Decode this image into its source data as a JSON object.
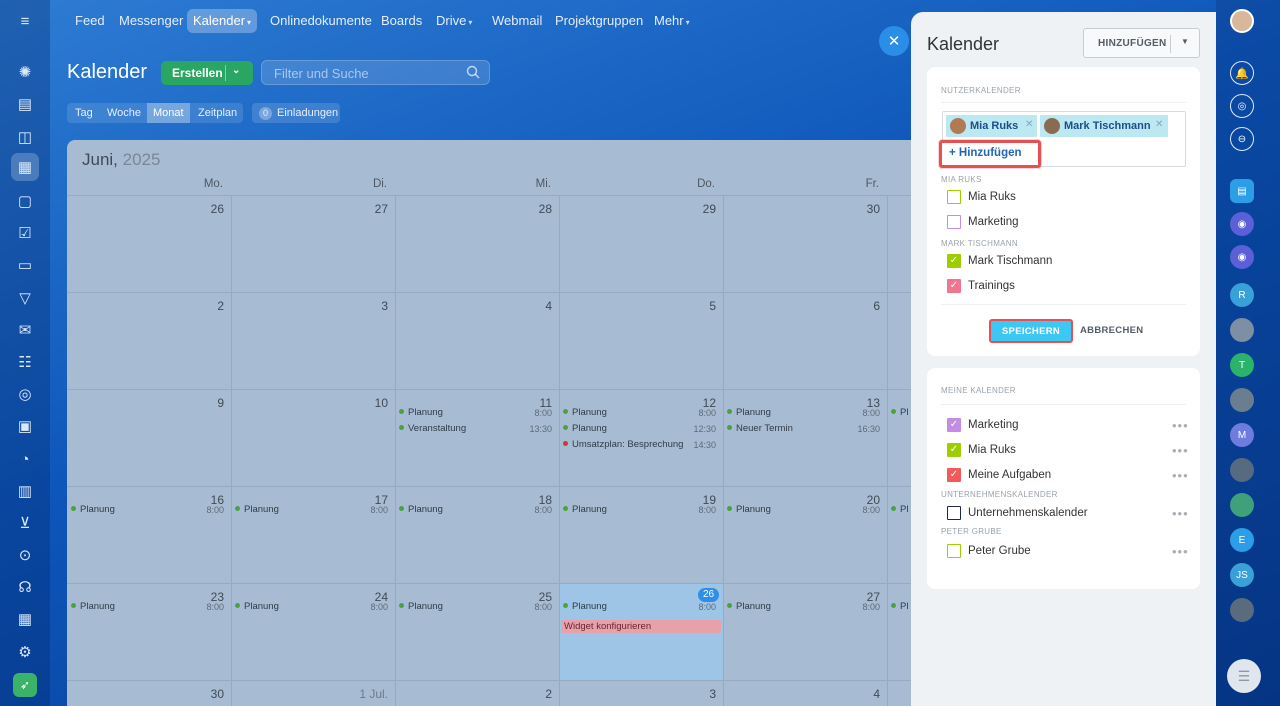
{
  "topnav": {
    "items": [
      {
        "label": "Feed"
      },
      {
        "label": "Messenger"
      },
      {
        "label": "Kalender"
      },
      {
        "label": "Onlinedokumente"
      },
      {
        "label": "Boards"
      },
      {
        "label": "Drive"
      },
      {
        "label": "Webmail"
      },
      {
        "label": "Projektgruppen"
      },
      {
        "label": "Mehr"
      }
    ]
  },
  "calendar": {
    "title": "Kalender",
    "create_label": "Erstellen",
    "search_placeholder": "Filter und Suche",
    "views": [
      "Tag",
      "Woche",
      "Monat",
      "Zeitplan"
    ],
    "active_view": "Monat",
    "invitations_count": "0",
    "invitations_label": "Einladungen",
    "month_name": "Juni,",
    "year": "2025",
    "weekdays": [
      "Mo.",
      "Di.",
      "Mi.",
      "Do.",
      "Fr."
    ],
    "weeks": [
      {
        "days": [
          {
            "num": "26",
            "events": []
          },
          {
            "num": "27",
            "events": []
          },
          {
            "num": "28",
            "events": []
          },
          {
            "num": "29",
            "events": []
          },
          {
            "num": "30",
            "events": []
          }
        ]
      },
      {
        "days": [
          {
            "num": "2",
            "events": []
          },
          {
            "num": "3",
            "events": []
          },
          {
            "num": "4",
            "events": []
          },
          {
            "num": "5",
            "events": []
          },
          {
            "num": "6",
            "events": []
          }
        ]
      },
      {
        "days": [
          {
            "num": "9",
            "events": []
          },
          {
            "num": "10",
            "events": []
          },
          {
            "num": "11",
            "events": [
              {
                "title": "Planung",
                "time": "8:00"
              },
              {
                "title": "Veranstaltung",
                "time": "13:30"
              }
            ]
          },
          {
            "num": "12",
            "events": [
              {
                "title": "Planung",
                "time": "8:00"
              },
              {
                "title": "Planung",
                "time": "12:30"
              },
              {
                "title": "Umsatzplan: Besprechung",
                "time": "14:30",
                "color": "red"
              }
            ]
          },
          {
            "num": "13",
            "events": [
              {
                "title": "Planung",
                "time": "8:00"
              },
              {
                "title": "Neuer Termin",
                "time": "16:30"
              }
            ]
          }
        ]
      },
      {
        "days": [
          {
            "num": "16",
            "events": [
              {
                "title": "Planung",
                "time": "8:00"
              }
            ]
          },
          {
            "num": "17",
            "events": [
              {
                "title": "Planung",
                "time": "8:00"
              }
            ]
          },
          {
            "num": "18",
            "events": [
              {
                "title": "Planung",
                "time": "8:00"
              }
            ]
          },
          {
            "num": "19",
            "events": [
              {
                "title": "Planung",
                "time": "8:00"
              }
            ]
          },
          {
            "num": "20",
            "events": [
              {
                "title": "Planung",
                "time": "8:00"
              }
            ]
          }
        ]
      },
      {
        "days": [
          {
            "num": "23",
            "events": [
              {
                "title": "Planung",
                "time": "8:00"
              }
            ]
          },
          {
            "num": "24",
            "events": [
              {
                "title": "Planung",
                "time": "8:00"
              }
            ]
          },
          {
            "num": "25",
            "events": [
              {
                "title": "Planung",
                "time": "8:00"
              }
            ]
          },
          {
            "num": "26",
            "today": true,
            "events": [
              {
                "title": "Planung",
                "time": "8:00"
              }
            ]
          },
          {
            "num": "27",
            "events": [
              {
                "title": "Planung",
                "time": "8:00"
              }
            ]
          }
        ]
      },
      {
        "days": [
          {
            "num": "30",
            "events": []
          },
          {
            "num": "1 Jul.",
            "events": []
          },
          {
            "num": "2",
            "events": []
          },
          {
            "num": "3",
            "events": []
          },
          {
            "num": "4",
            "events": []
          }
        ]
      }
    ],
    "widget_event": "Widget konfigurieren",
    "overflow_label": "Pl"
  },
  "panel": {
    "title": "Kalender",
    "add_button_label": "HINZUFÜGEN",
    "user_calendars_heading": "NUTZERKALENDER",
    "selected_users": [
      {
        "name": "Mia Ruks",
        "avatar_color": "#b07a55"
      },
      {
        "name": "Mark Tischmann",
        "avatar_color": "#8a6a50"
      }
    ],
    "add_user_label": "+ Hinzufügen",
    "groups": [
      {
        "heading": "MIA RUKS",
        "items": [
          {
            "label": "Mia Ruks",
            "color": "#9dcf00",
            "checked": false
          },
          {
            "label": "Marketing",
            "color": "#c38de3",
            "checked": false
          }
        ]
      },
      {
        "heading": "MARK TISCHMANN",
        "items": [
          {
            "label": "Mark Tischmann",
            "color": "#9dcf00",
            "checked": true
          },
          {
            "label": "Trainings",
            "color": "#f0758e",
            "checked": true
          }
        ]
      }
    ],
    "save_label": "SPEICHERN",
    "cancel_label": "ABBRECHEN",
    "my_calendars_heading": "MEINE KALENDER",
    "my_calendars": [
      {
        "label": "Marketing",
        "color": "#c38de3",
        "checked": true
      },
      {
        "label": "Mia Ruks",
        "color": "#9dcf00",
        "checked": true
      },
      {
        "label": "Meine Aufgaben",
        "color": "#f25a5a",
        "checked": true
      }
    ],
    "company_heading": "UNTERNEHMENSKALENDER",
    "company_calendars": [
      {
        "label": "Unternehmenskalender",
        "color": "#1e2a44",
        "checked": false
      }
    ],
    "peter_heading": "PETER GRUBE",
    "peter_calendars": [
      {
        "label": "Peter Grube",
        "color": "#9dcf00",
        "checked": false
      }
    ]
  },
  "rightbar": {
    "avatars": [
      {
        "kind": "bell-icon"
      },
      {
        "kind": "pulse-icon"
      },
      {
        "kind": "search-chat-icon"
      },
      {
        "kind": "chat",
        "color": "#2c9ee8"
      },
      {
        "kind": "channel",
        "color": "#5b5fd8"
      },
      {
        "kind": "channel",
        "color": "#5b5fd8"
      },
      {
        "kind": "letter",
        "letter": "R",
        "color": "#3aa0d8"
      },
      {
        "kind": "photo",
        "color": "#7e8fa3"
      },
      {
        "kind": "letter",
        "letter": "T",
        "color": "#2bb36b"
      },
      {
        "kind": "photo",
        "color": "#6b7e90"
      },
      {
        "kind": "letter",
        "letter": "M",
        "color": "#6e7ce0"
      },
      {
        "kind": "photo",
        "color": "#566b80"
      },
      {
        "kind": "photo",
        "color": "#3fa07a"
      },
      {
        "kind": "letter",
        "letter": "E",
        "color": "#2c9ee8"
      },
      {
        "kind": "letter",
        "letter": "JS",
        "color": "#3aa0d8"
      },
      {
        "kind": "photo",
        "color": "#5a6b7e"
      }
    ]
  }
}
